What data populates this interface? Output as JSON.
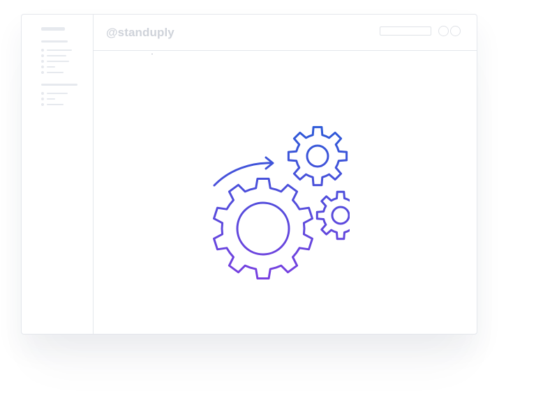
{
  "channel": {
    "name": "@standuply"
  },
  "illustration": {
    "icons": [
      "large-gear-icon",
      "top-gear-icon",
      "small-gear-icon",
      "curved-arrow-icon"
    ],
    "gradient_start": "#2a5bd7",
    "gradient_end": "#7a3fe0"
  },
  "colors": {
    "border": "#e4e7ec",
    "placeholder": "#e6e9ee",
    "channel_text": "#cfd3da"
  }
}
